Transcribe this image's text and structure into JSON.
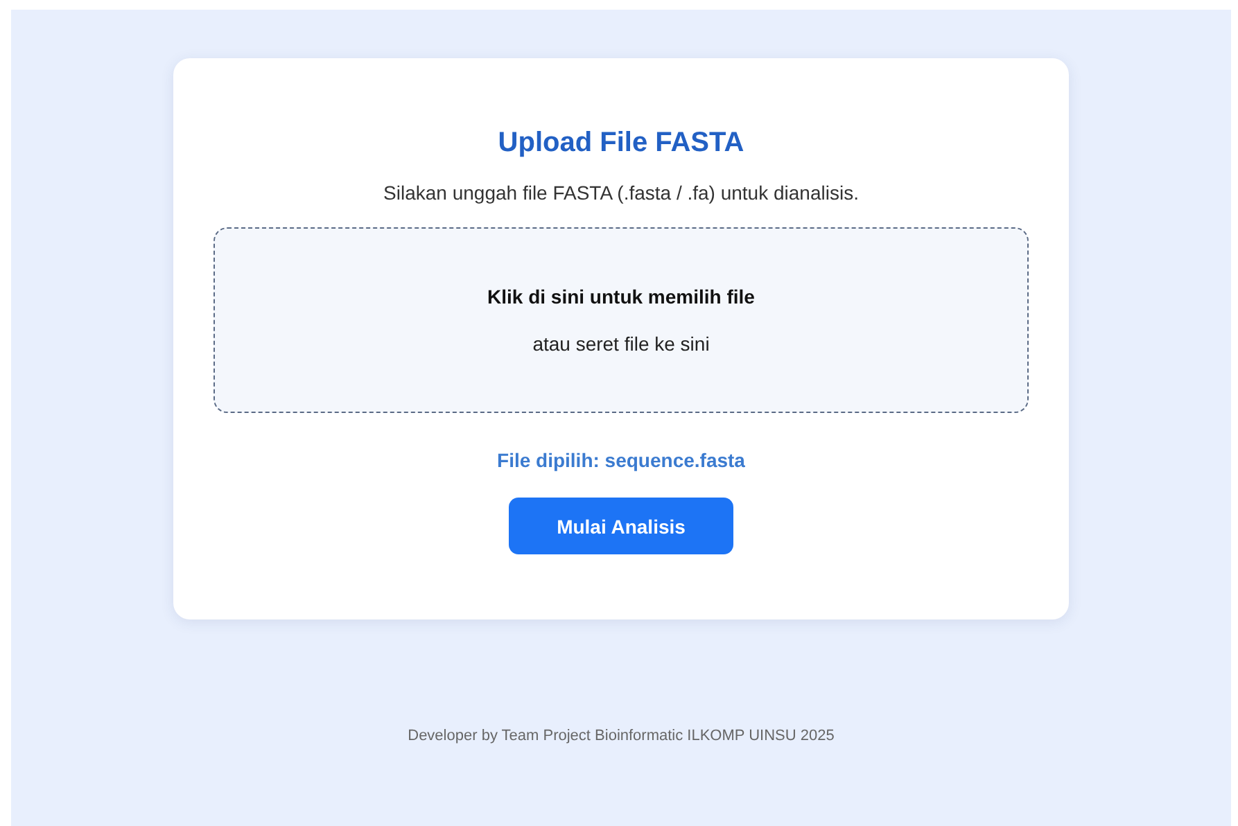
{
  "card": {
    "title": "Upload File FASTA",
    "subtitle": "Silakan unggah file FASTA (.fasta / .fa) untuk dianalisis."
  },
  "dropzone": {
    "prompt": "Klik di sini untuk memilih file",
    "hint": "atau seret file ke sini"
  },
  "selected_file": "File dipilih: sequence.fasta",
  "button": "Mulai Analisis",
  "footer": "Developer by Team Project Bioinformatic ILKOMP UINSU 2025"
}
